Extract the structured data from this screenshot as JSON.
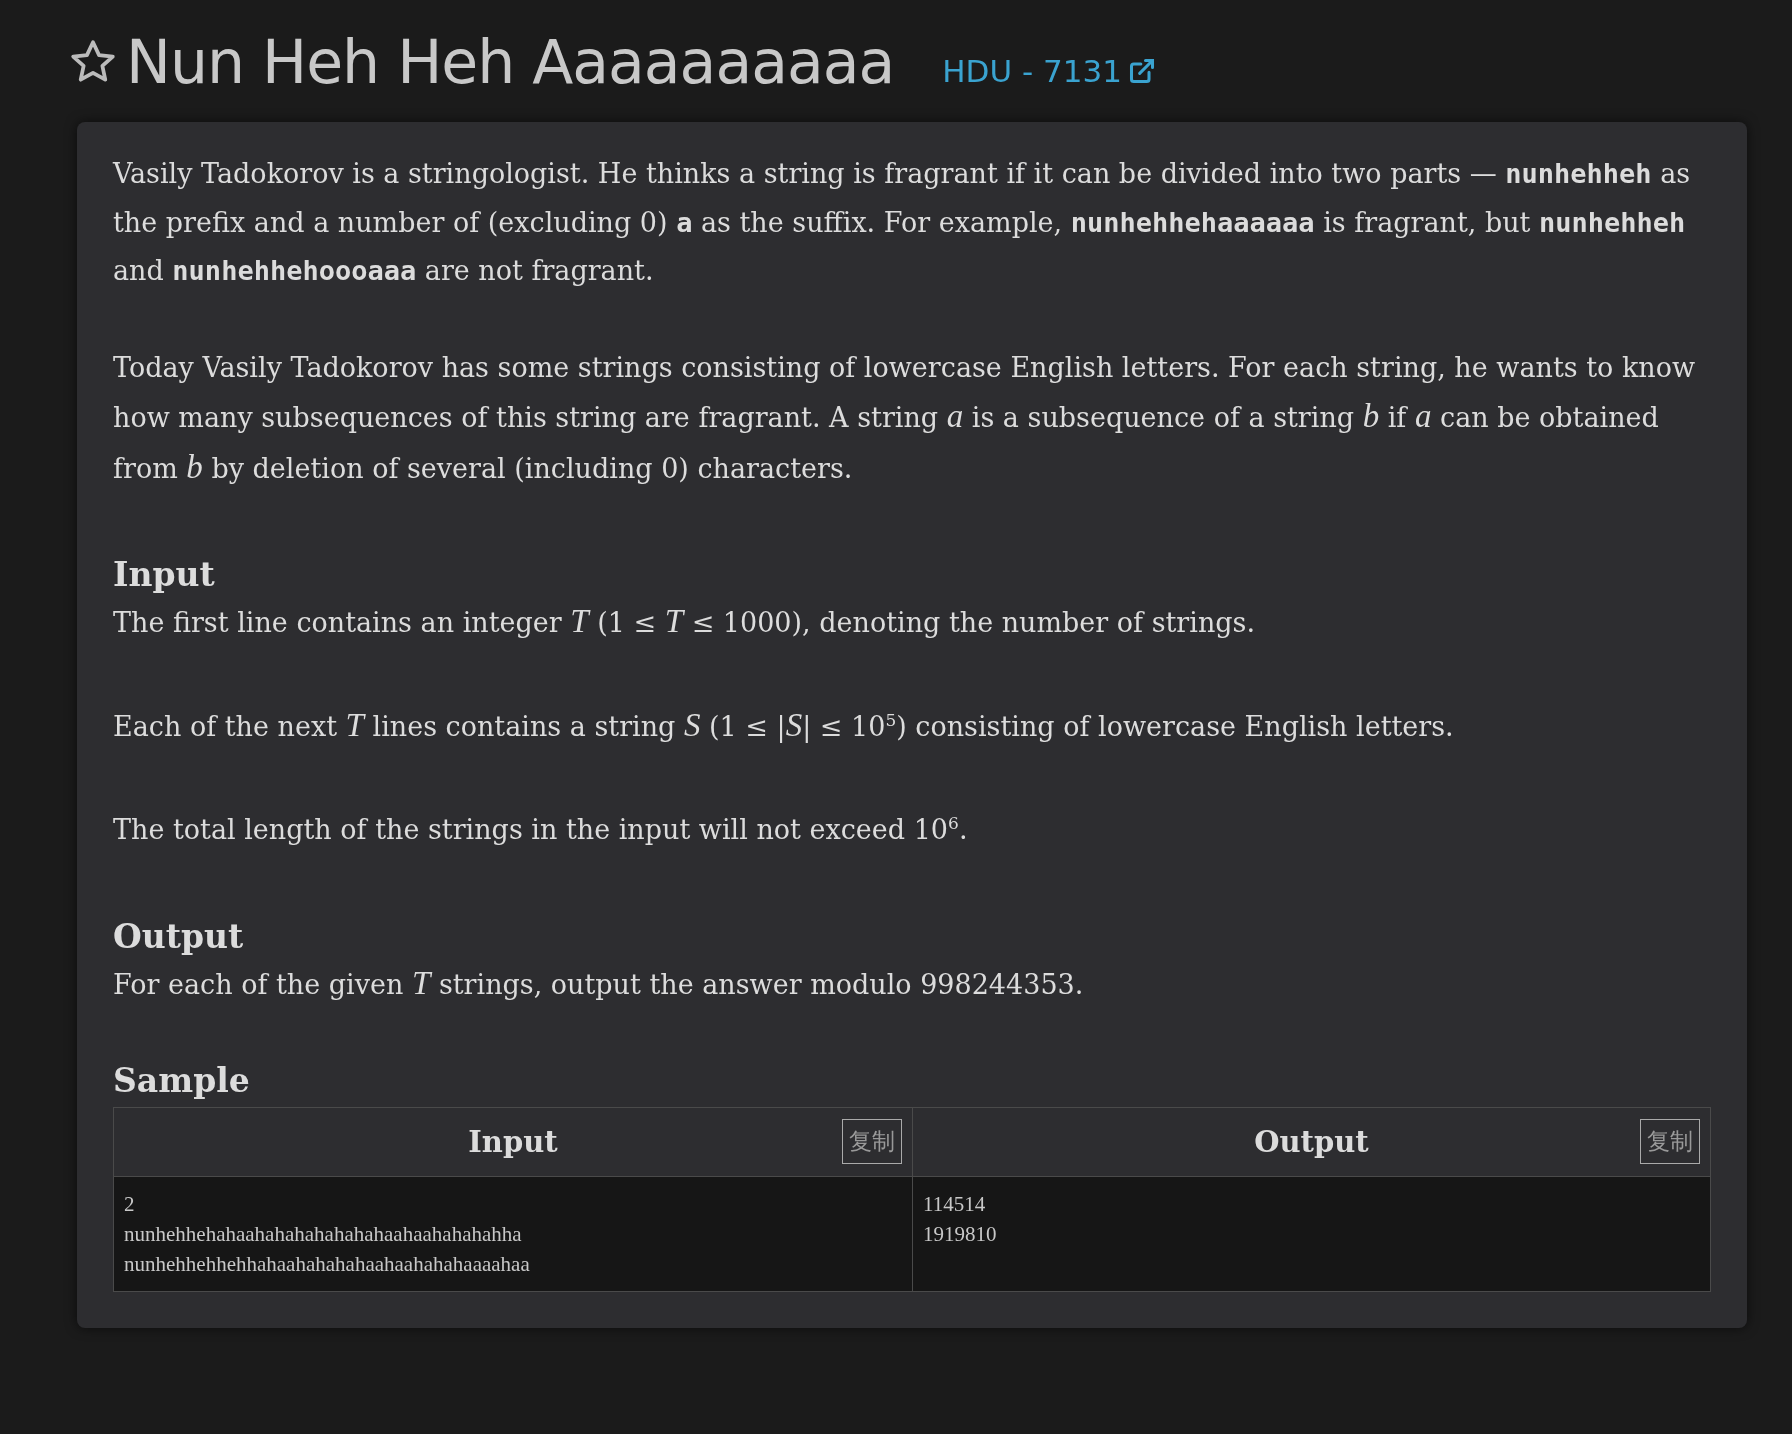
{
  "header": {
    "title": "Nun Heh Heh Aaaaaaaaaa",
    "source_link": "HDU - 7131",
    "starred": false
  },
  "intro": [
    "Vasily Tadokorov is a stringologist. He thinks a string is fragrant if it can be divided into two parts — **nunhehheh** as the prefix and a number of (excluding 0) **a** as the suffix. For example, **nunhehhehaaaaaa** is fragrant, but **nunhehheh** and **nunhehhehoooaaa** are not fragrant.",
    "Today Vasily Tadokorov has some strings consisting of lowercase English letters. For each string, he wants to know how many subsequences of this string are fragrant. A string *a* is a subsequence of a string *b* if *a* can be obtained from *b* by deletion of several (including 0) characters."
  ],
  "sections": [
    {
      "heading": "Input",
      "paragraphs": [
        "The first line contains an integer *T* (1 ≤ *T* ≤ 1000), denoting the number of strings.",
        "Each of the next *T* lines contains a string *S* (1 ≤ |*S*| ≤ 10$^{5}$) consisting of lowercase English letters.",
        "The total length of the strings in the input will not exceed 10$^{6}$."
      ]
    },
    {
      "heading": "Output",
      "paragraphs": [
        "For each of the given *T* strings, output the answer modulo 998244353."
      ]
    }
  ],
  "sample": {
    "heading": "Sample",
    "columns": [
      {
        "title": "Input",
        "copy_button": "复制",
        "lines": [
          "2",
          "nunhehhehahaahahahahahahahaahaahahahahha",
          "nunhehhehhehhahaahahahahaahaahahahaaaahaa"
        ]
      },
      {
        "title": "Output",
        "copy_button": "复制",
        "lines": [
          "114514",
          "1919810"
        ]
      }
    ]
  }
}
